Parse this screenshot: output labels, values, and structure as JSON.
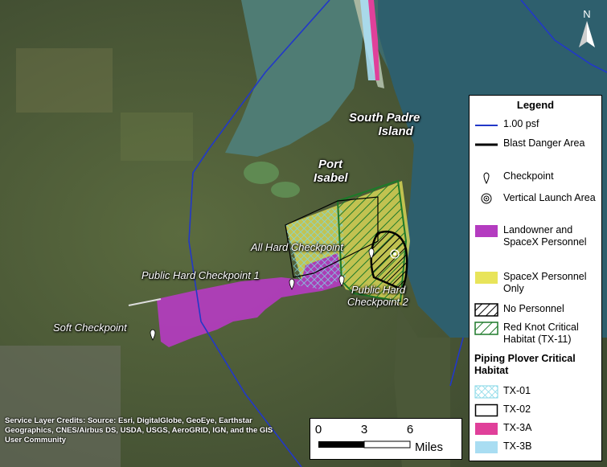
{
  "labels": {
    "south_padre": [
      "South Padre",
      "Island"
    ],
    "port_isabel": [
      "Port",
      "Isabel"
    ],
    "all_hard": "All Hard Checkpoint",
    "public_hard_1": "Public Hard Checkpoint 1",
    "public_hard_2": [
      "Public Hard",
      "Checkpoint 2"
    ],
    "soft": "Soft Checkpoint"
  },
  "legend": {
    "title": "Legend",
    "items": [
      {
        "label": "1.00 psf",
        "symbol": "blue-line"
      },
      {
        "label": "Blast Danger Area",
        "symbol": "black-line"
      },
      {
        "label": "Checkpoint",
        "symbol": "pin"
      },
      {
        "label": "Vertical Launch Area",
        "symbol": "target"
      },
      {
        "label": "Landowner and SpaceX Personnel",
        "symbol": "purple-fill"
      },
      {
        "label": "SpaceX Personnel Only",
        "symbol": "yellow-fill"
      },
      {
        "label": "No Personnel",
        "symbol": "black-hatch"
      },
      {
        "label": "Red Knot Critical Habitat (TX-11)",
        "symbol": "green-hatch"
      }
    ],
    "plover_title": "Piping Plover Critical Habitat",
    "plover_items": [
      {
        "label": "TX-01",
        "symbol": "cyan-hatch"
      },
      {
        "label": "TX-02",
        "symbol": "black-outline"
      },
      {
        "label": "TX-3A",
        "symbol": "magenta-fill"
      },
      {
        "label": "TX-3B",
        "symbol": "lightblue-fill"
      }
    ]
  },
  "credits": "Service Layer Credits: Source: Esri, DigitalGlobe, GeoEye, Earthstar Geographics, CNES/Airbus DS, USDA, USGS, AeroGRID, IGN, and the GIS User Community",
  "scale": {
    "ticks": [
      "0",
      "3",
      "6"
    ],
    "unit": "Miles"
  },
  "north": "N",
  "colors": {
    "psf_line": "#2238c8",
    "landowner": "#b43cc0",
    "spacex_only": "#e8e45a",
    "red_knot": "#1e7a2a",
    "tx01": "#7fd6e6",
    "tx3a": "#e0409a",
    "tx3b": "#a9ddf2"
  }
}
